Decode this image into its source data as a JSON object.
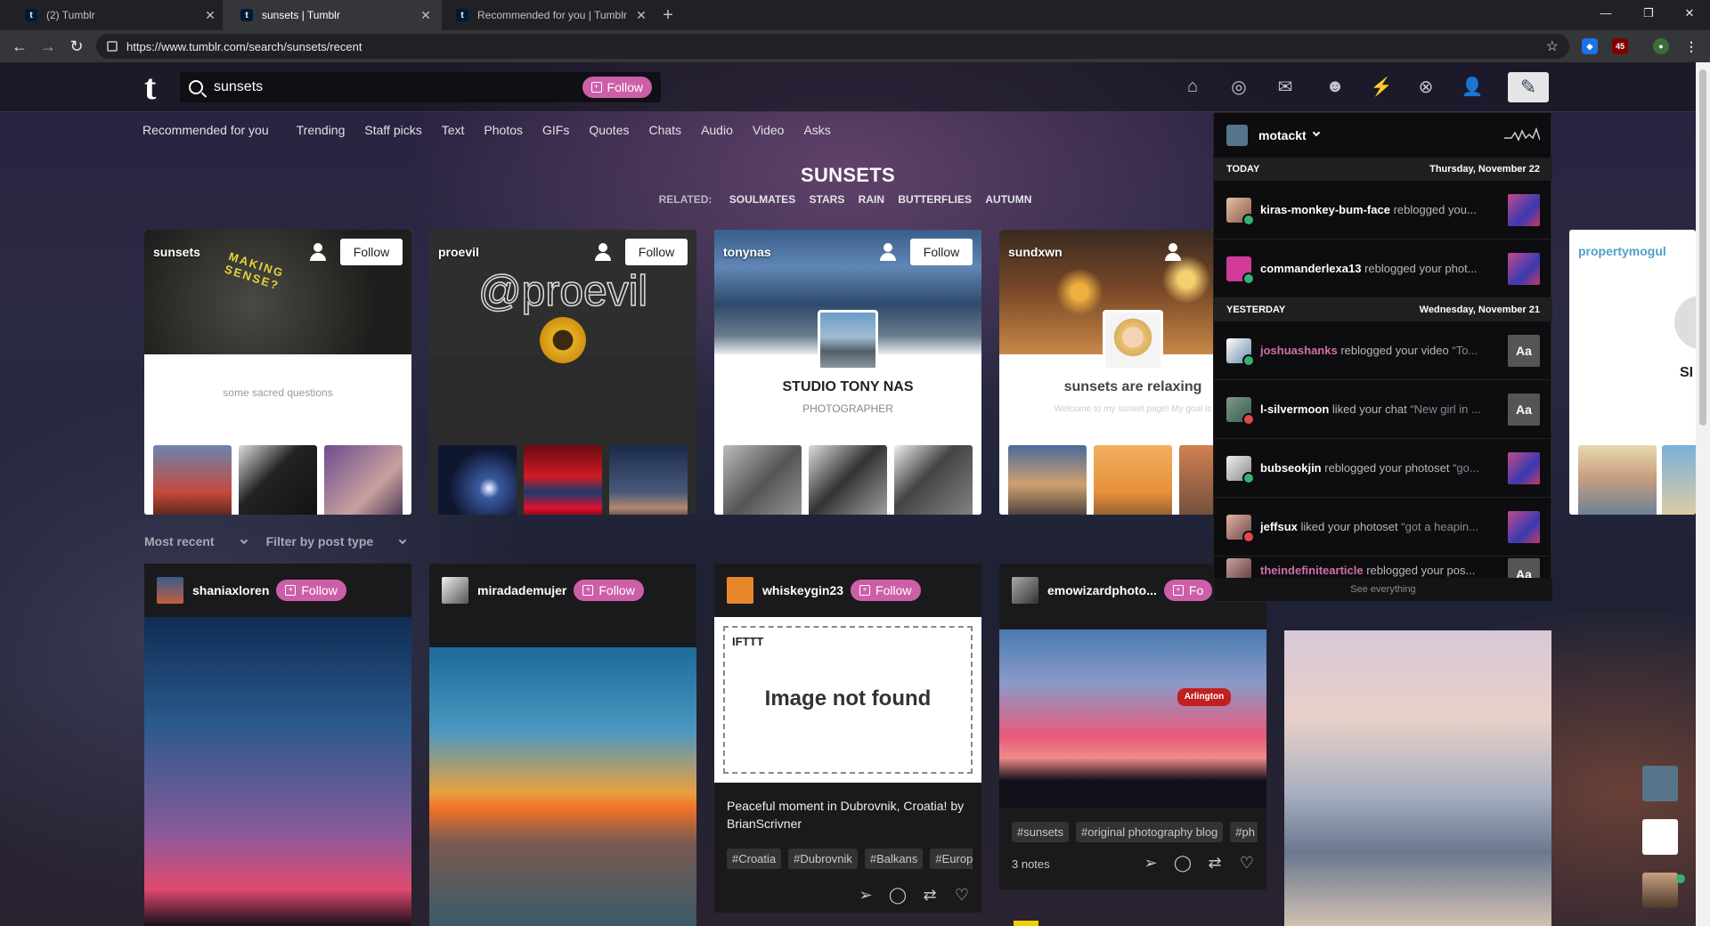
{
  "browser": {
    "tabs": [
      {
        "title": "(2) Tumblr",
        "active": false
      },
      {
        "title": "sunsets | Tumblr",
        "active": true
      },
      {
        "title": "Recommended for you | Tumblr",
        "active": false
      }
    ],
    "url": "https://www.tumblr.com/search/sunsets/recent",
    "ext_badge": "45"
  },
  "header": {
    "logo": "t",
    "search_value": "sunsets",
    "follow_label": "Follow"
  },
  "nav": [
    "Recommended for you",
    "Trending",
    "Staff picks",
    "Text",
    "Photos",
    "GIFs",
    "Quotes",
    "Chats",
    "Audio",
    "Video",
    "Asks"
  ],
  "search": {
    "title": "SUNSETS",
    "related_label": "RELATED:",
    "related": [
      "SOULMATES",
      "STARS",
      "RAIN",
      "BUTTERFLIES",
      "AUTUMN"
    ]
  },
  "cards": [
    {
      "name": "sunsets",
      "follow": "Follow",
      "desc": "some sacred questions",
      "overlay": "MAKING SENSE?"
    },
    {
      "name": "proevil",
      "follow": "Follow",
      "overlay": "@proevil"
    },
    {
      "name": "tonynas",
      "follow": "Follow",
      "title": "STUDIO TONY NAS",
      "subtitle": "PHOTOGRAPHER"
    },
    {
      "name": "sundxwn",
      "follow": "Follow",
      "title": "sunsets are relaxing",
      "subtitle": "Welcome to my sunset page! My goal is"
    },
    {
      "name": "propertymogul",
      "title": "SI"
    }
  ],
  "filters": {
    "recent": "Most recent",
    "type": "Filter by post type"
  },
  "posts": [
    {
      "blog": "shaniaxloren",
      "follow": "Follow"
    },
    {
      "blog": "miradademujer",
      "follow": "Follow"
    },
    {
      "blog": "whiskeygin23",
      "follow": "Follow",
      "ifttt": "IFTTT",
      "notfound": "Image not found",
      "caption": "Peaceful moment in Dubrovnik, Croatia! by BrianScrivner",
      "tags": [
        "#Croatia",
        "#Dubrovnik",
        "#Balkans",
        "#Europ"
      ]
    },
    {
      "blog": "emowizardphoto...",
      "follow": "Fo",
      "tags": [
        "#sunsets",
        "#original photography blog",
        "#ph"
      ],
      "notes": "3 notes"
    }
  ],
  "activity": {
    "user": "motackt",
    "today": {
      "label": "TODAY",
      "date": "Thursday, November 22"
    },
    "yesterday": {
      "label": "YESTERDAY",
      "date": "Wednesday, November 21"
    },
    "items": [
      {
        "user": "kiras-monkey-bum-face",
        "action": " reblogged you...",
        "quote": "",
        "thumb": ""
      },
      {
        "user": "commanderlexa13",
        "action": " reblogged your phot...",
        "quote": "",
        "thumb": ""
      },
      {
        "user": "joshuashanks",
        "action": " reblogged your video ",
        "quote": "“To...",
        "thumb": "Aa"
      },
      {
        "user": "l-silvermoon",
        "action": " liked your chat ",
        "quote": "“New girl in ...",
        "thumb": "Aa"
      },
      {
        "user": "bubseokjin",
        "action": " reblogged your photoset ",
        "quote": "“go...",
        "thumb": ""
      },
      {
        "user": "jeffsux",
        "action": " liked your photoset ",
        "quote": "“got a heapin...",
        "thumb": ""
      },
      {
        "user": "theindefinitearticle",
        "action": " reblogged your pos...",
        "quote": "",
        "thumb": "Aa"
      }
    ],
    "see_all": "See everything"
  },
  "colors": {
    "accent": "#cd5fa9",
    "tumblr_blue": "#001935"
  }
}
